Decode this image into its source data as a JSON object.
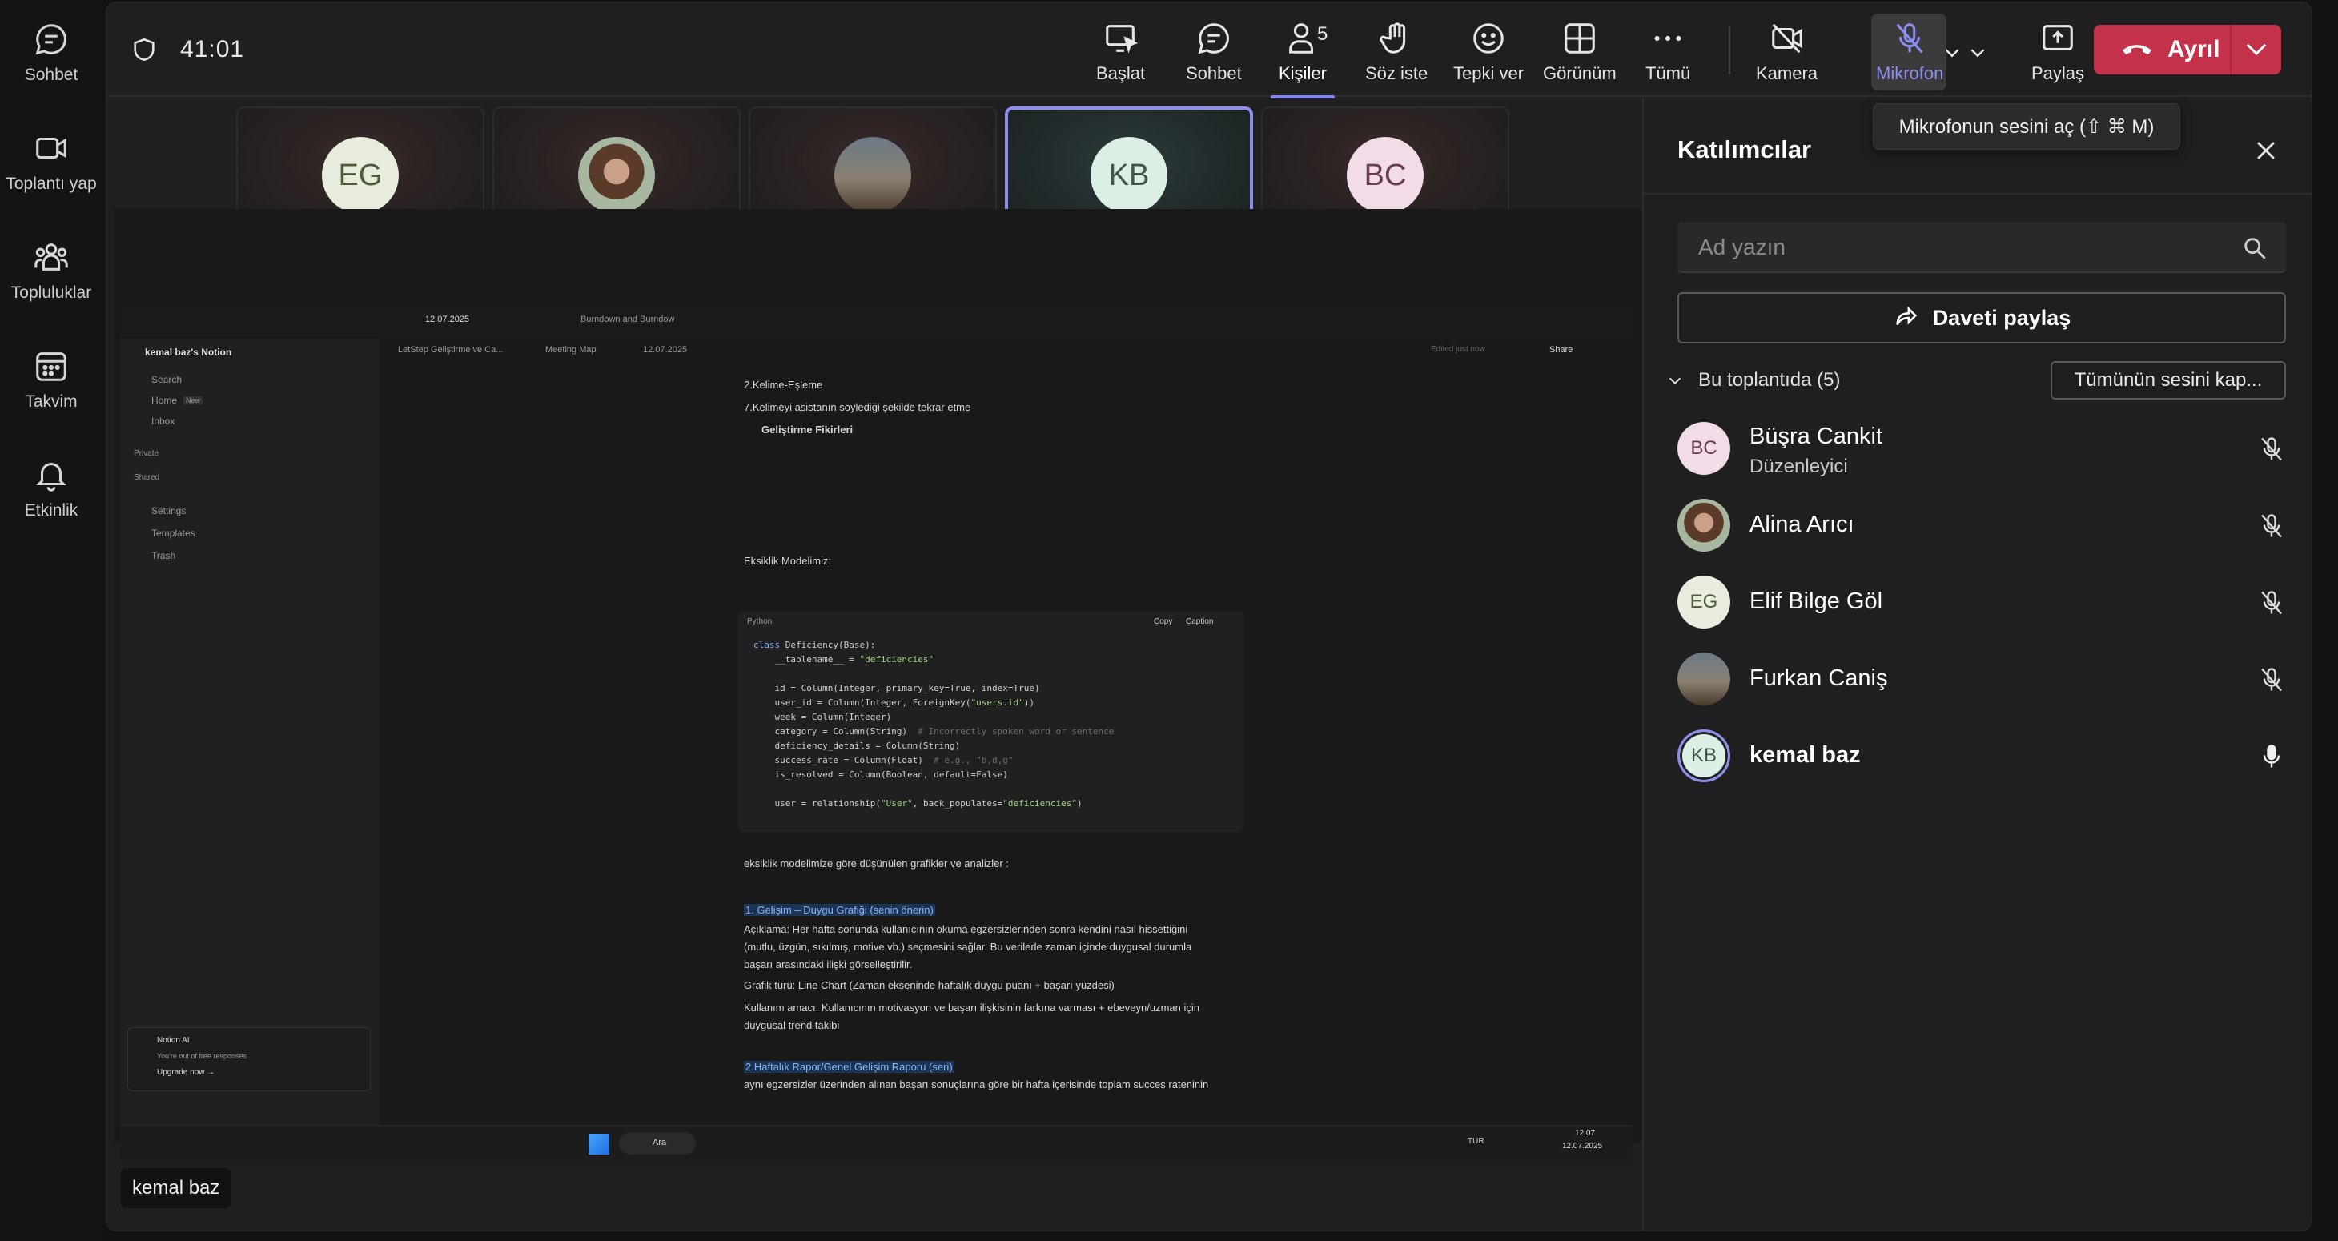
{
  "rail": {
    "items": [
      {
        "label": "Sohbet",
        "icon": "chat-icon"
      },
      {
        "label": "Toplantı yap",
        "icon": "video-camera-icon"
      },
      {
        "label": "Topluluklar",
        "icon": "communities-icon"
      },
      {
        "label": "Takvim",
        "icon": "calendar-icon"
      },
      {
        "label": "Etkinlik",
        "icon": "bell-icon"
      }
    ]
  },
  "toolbar": {
    "timer": "41:01",
    "start_label": "Başlat",
    "chat_label": "Sohbet",
    "people_label": "Kişiler",
    "people_count": "5",
    "raise_hand_label": "Söz iste",
    "react_label": "Tepki ver",
    "view_label": "Görünüm",
    "more_label": "Tümü",
    "camera_label": "Kamera",
    "mic_label": "Mikrofon",
    "share_label": "Paylaş",
    "leave_label": "Ayrıl",
    "mic_tooltip": "Mikrofonun sesini aç (⇧ ⌘ M)"
  },
  "tiles": [
    {
      "initials": "EG",
      "color": "#e7ecdc",
      "text_color": "#4f5c3c",
      "muted": true,
      "selected": false
    },
    {
      "initials": "",
      "photo": true,
      "muted": true,
      "selected": false
    },
    {
      "initials": "",
      "photo": true,
      "muted": true,
      "selected": false
    },
    {
      "initials": "KB",
      "color": "#dcefe4",
      "text_color": "#3c5a48",
      "muted": false,
      "selected": true
    },
    {
      "initials": "BC",
      "color": "#f2dce8",
      "text_color": "#6a3c54",
      "muted": true,
      "selected": false
    }
  ],
  "shared_screen": {
    "workspace": "kemal baz's Notion",
    "sidebar": [
      "Search",
      "Home",
      "Inbox",
      "Private",
      "Shared",
      "Settings",
      "Templates",
      "Trash"
    ],
    "home_badge": "New",
    "tabs": [
      "12.07.2025",
      "Burndown and Burndow"
    ],
    "breadcrumb": [
      "LetStep Geliştirme ve Ca...",
      "Meeting Map",
      "12.07.2025"
    ],
    "edited": "Edited just now",
    "share": "Share",
    "lines": {
      "l1": "2.Kelime-Eşleme",
      "l2": "7.Kelimeyi asistanın söylediği şekilde tekrar etme",
      "l3": "Geliştirme Fikirleri",
      "l4": "Eksiklik Modelimiz:",
      "l5": "eksiklik modelimize göre düşünülen grafikler ve analizler :",
      "l6": "1. Gelişim – Duygu Grafiği (senin önerin)",
      "l7": "Açıklama: Her hafta sonunda kullanıcının okuma egzersizlerinden sonra kendini nasıl hissettiğini",
      "l8": "(mutlu, üzgün, sıkılmış, motive vb.) seçmesini sağlar. Bu verilerle zaman içinde duygusal durumla",
      "l9": "başarı arasındaki ilişki görselleştirilir.",
      "l10": "Grafik türü: Line Chart (Zaman ekseninde haftalık duygu puanı + başarı yüzdesi)",
      "l11": "Kullanım amacı: Kullanıcının motivasyon ve başarı ilişkisinin farkına varması + ebeveyn/uzman için",
      "l12": "duygusal trend takibi",
      "l13": "2.Haftalık Rapor/Genel Gelişim Raporu (seri)",
      "l14": "aynı egzersizler üzerinden alınan başarı sonuçlarına göre bir hafta içerisinde toplam succes rateninin"
    },
    "code_lang": "Python",
    "code_copy": "Copy",
    "code_caption": "Caption",
    "notion_ai": "Notion AI",
    "notion_ai_sub": "You're out of free responses",
    "upgrade": "Upgrade now →",
    "taskbar_search": "Ara",
    "taskbar_lang": "TUR",
    "taskbar_time": "12:07",
    "taskbar_date": "12.07.2025"
  },
  "presenter_name": "kemal baz",
  "panel": {
    "title": "Katılımcılar",
    "search_placeholder": "Ad yazın",
    "invite_label": "Daveti paylaş",
    "section_label": "Bu toplantıda (5)",
    "mute_all_label": "Tümünün sesini kap...",
    "people": [
      {
        "name": "Büşra Cankit",
        "role": "Düzenleyici",
        "initials": "BC",
        "color": "#f2dce8",
        "text_color": "#6a3c54",
        "muted": true
      },
      {
        "name": "Alina Arıcı",
        "role": "",
        "initials": "",
        "photo": true,
        "muted": true
      },
      {
        "name": "Elif Bilge Göl",
        "role": "",
        "initials": "EG",
        "color": "#e7ecdc",
        "text_color": "#4f5c3c",
        "muted": true
      },
      {
        "name": "Furkan Caniş",
        "role": "",
        "initials": "",
        "photo": true,
        "muted": true
      },
      {
        "name": "kemal baz",
        "role": "",
        "initials": "KB",
        "color": "#dcefe4",
        "text_color": "#3c5a48",
        "muted": false
      }
    ]
  },
  "colors": {
    "accent": "#7f85f5",
    "leave": "#c4314b"
  }
}
